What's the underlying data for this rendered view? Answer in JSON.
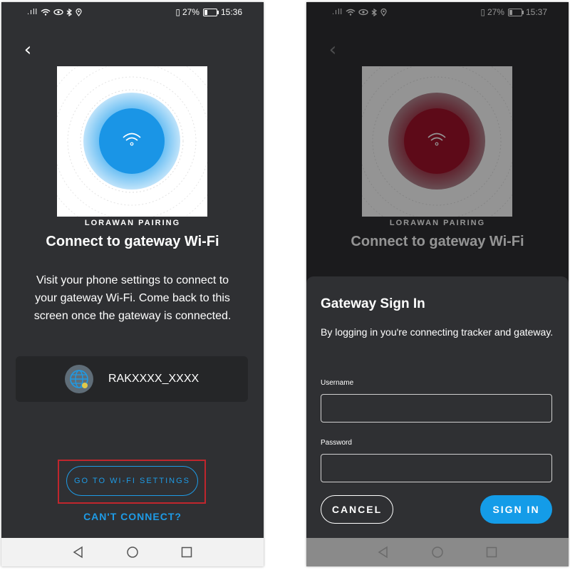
{
  "colors": {
    "background": "#2f3033",
    "accent": "#1e9be6",
    "highlight": "#c0262d",
    "card": "#252628"
  },
  "left": {
    "status": {
      "signal": ".ıll",
      "icons": "wifi-icon eye-icon bluetooth-icon location-icon",
      "vibrate": "▯",
      "battery_percent": "27%",
      "time": "15:36"
    },
    "back_icon": "‹",
    "eyebrow": "LORAWAN PAIRING",
    "title": "Connect to gateway Wi-Fi",
    "instructions": "Visit your phone settings to connect to your gateway Wi-Fi. Come back to this screen once the gateway is connected.",
    "network_name": "RAKXXXX_XXXX",
    "wifi_button": "GO TO WI-FI SETTINGS",
    "cant_connect": "CAN'T CONNECT?"
  },
  "right": {
    "status": {
      "signal": ".ıll",
      "battery_percent": "27%",
      "time": "15:37"
    },
    "eyebrow": "LORAWAN PAIRING",
    "title": "Connect to gateway Wi-Fi",
    "sheet": {
      "title": "Gateway Sign In",
      "description": "By logging in you're connecting tracker and gateway.",
      "username_label": "Username",
      "username_value": "",
      "password_label": "Password",
      "password_value": "",
      "cancel": "CANCEL",
      "sign_in": "SIGN IN"
    }
  }
}
